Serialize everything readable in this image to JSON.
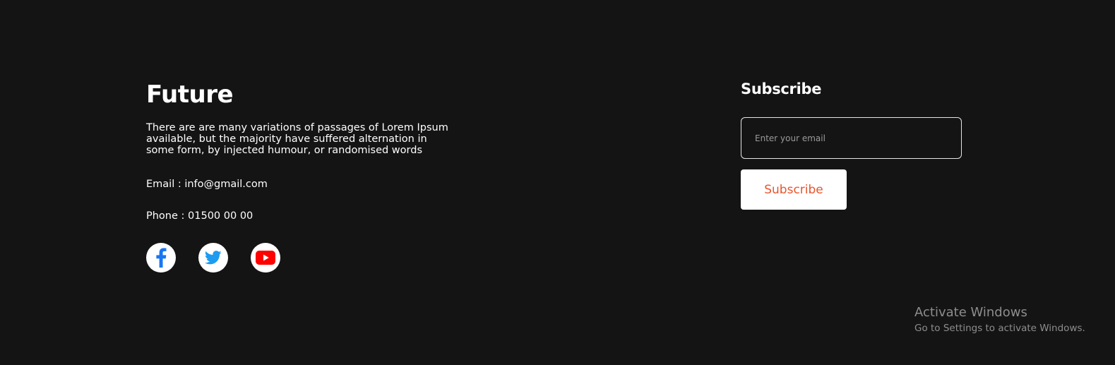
{
  "brand": {
    "title": "Future",
    "description": "There are are many variations of passages of Lorem Ipsum available, but the majority have suffered alternation in some form, by injected humour, or randomised words"
  },
  "contact": {
    "email_text": "Email : info@gmail.com",
    "phone_text": "Phone : 01500 00 00"
  },
  "social": {
    "items": [
      {
        "icon": "facebook-icon",
        "color": "#1877f2"
      },
      {
        "icon": "twitter-icon",
        "color": "#1d9bf0"
      },
      {
        "icon": "youtube-icon",
        "color": "#ff0000"
      }
    ]
  },
  "subscribe": {
    "title": "Subscribe",
    "input_placeholder": "Enter your email",
    "button_label": "Subscribe",
    "button_text_color": "#e8542b"
  },
  "windows_watermark": {
    "title": "Activate Windows",
    "subtitle": "Go to Settings to activate Windows."
  },
  "colors": {
    "background": "#141414",
    "text": "#ffffff"
  }
}
